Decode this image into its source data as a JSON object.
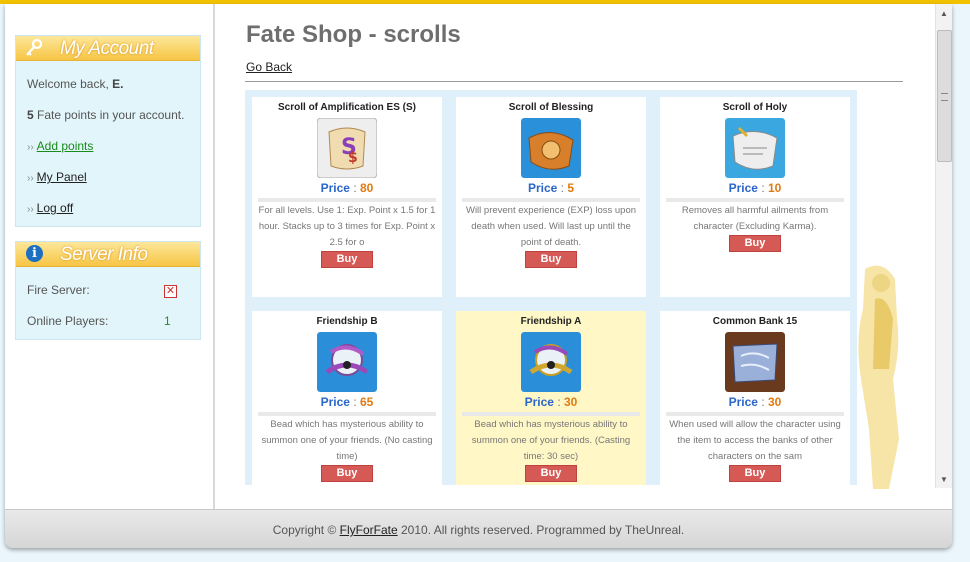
{
  "account": {
    "title": "My Account",
    "welcome_prefix": "Welcome back,",
    "username": "E.",
    "points_value": "5",
    "points_text": "Fate points in your account.",
    "links": [
      "Add points",
      "My Panel",
      "Log off"
    ]
  },
  "server": {
    "title": "Server Info",
    "fire_label": "Fire Server:",
    "online_label": "Online Players:",
    "online_value": "1"
  },
  "main": {
    "title": "Fate Shop - scrolls",
    "go_back": "Go Back",
    "price_label": "Price",
    "buy_label": "Buy",
    "items": [
      {
        "name": "Scroll of Amplification ES (S)",
        "price": "80",
        "desc": "For all levels. Use 1: Exp. Point x 1.5 for 1 hour. Stacks up to 3 times for Exp. Point x 2.5 for o",
        "icon": "scroll-amplification-icon"
      },
      {
        "name": "Scroll of Blessing",
        "price": "5",
        "desc": "Will prevent experience (EXP) loss upon death when used. Will last up until the point of death.",
        "icon": "scroll-blessing-icon"
      },
      {
        "name": "Scroll of Holy",
        "price": "10",
        "desc": "Removes all harmful ailments from character (Excluding Karma).",
        "icon": "scroll-holy-icon"
      },
      {
        "name": "Friendship B",
        "price": "65",
        "desc": "Bead which has mysterious ability to summon one of your friends. (No casting time)",
        "icon": "friendship-bead-icon"
      },
      {
        "name": "Friendship A",
        "price": "30",
        "desc": "Bead which has mysterious ability to summon one of your friends. (Casting time: 30 sec)",
        "icon": "friendship-bead-icon"
      },
      {
        "name": "Common Bank 15",
        "price": "30",
        "desc": "When used will allow the character using the item to access the banks of other characters on the sam",
        "icon": "common-bank-scroll-icon"
      }
    ]
  },
  "footer": {
    "copyright": "Copyright ©",
    "brand": "FlyForFate",
    "rest": "2010. All rights reserved. Programmed by TheUnreal."
  },
  "colors": {
    "accent_yellow": "#f6c544",
    "panel_bg": "#e2f5fb",
    "price_blue": "#2a66c9",
    "price_orange": "#e07a10",
    "buy_red": "#d55a56"
  }
}
